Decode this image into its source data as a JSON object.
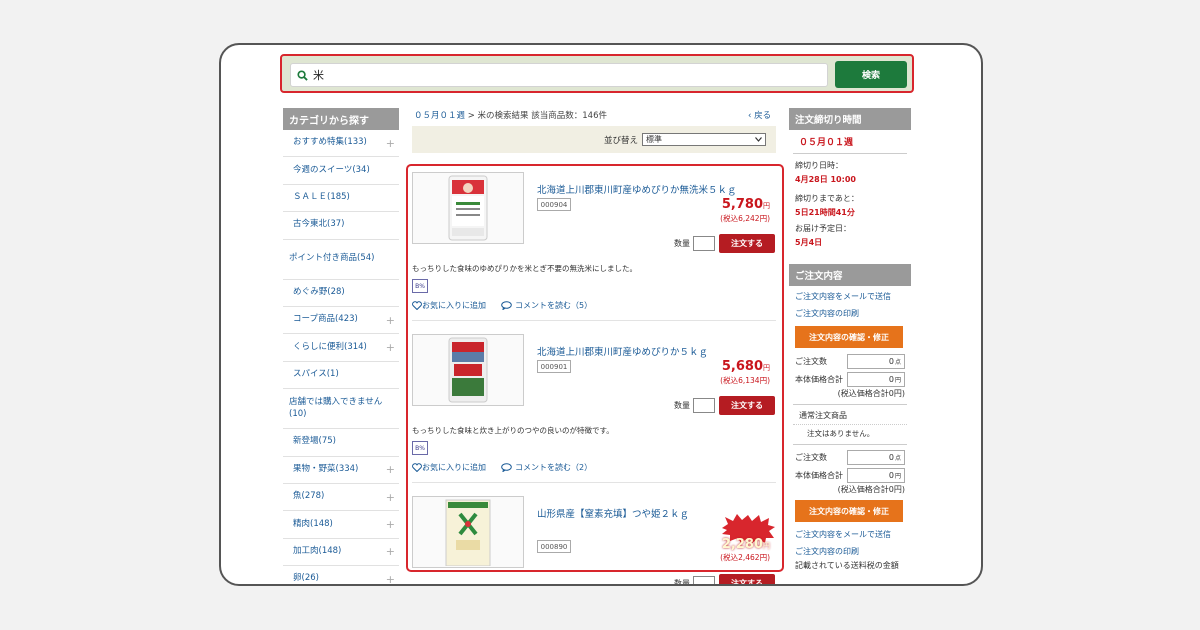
{
  "search": {
    "query": "米",
    "button_label": "検索"
  },
  "categories": {
    "header": "カテゴリから探す",
    "items": [
      {
        "label": "おすすめ特集(133)",
        "plus": true
      },
      {
        "label": "今週のスイーツ(34)",
        "plus": false
      },
      {
        "label": "ＳＡＬＥ(185)",
        "plus": false
      },
      {
        "label": "古今東北(37)",
        "plus": false
      },
      {
        "label": "ポイント付き商品(54)",
        "plus": false
      },
      {
        "label": "めぐみ野(28)",
        "plus": false
      },
      {
        "label": "コープ商品(423)",
        "plus": true
      },
      {
        "label": "くらしに便利(314)",
        "plus": true
      },
      {
        "label": "スパイス(1)",
        "plus": false
      },
      {
        "label": "店舗では購入できません(10)",
        "plus": false
      },
      {
        "label": "新登場(75)",
        "plus": false
      },
      {
        "label": "果物・野菜(334)",
        "plus": true
      },
      {
        "label": "魚(278)",
        "plus": true
      },
      {
        "label": "精肉(148)",
        "plus": true
      },
      {
        "label": "加工肉(148)",
        "plus": true
      },
      {
        "label": "卵(26)",
        "plus": true
      }
    ]
  },
  "breadcrumb": {
    "week_link": "０５月０１週",
    "separator": ">",
    "result_text": "米の検索結果 該当商品数：146件",
    "back_label": "戻る"
  },
  "sort": {
    "label": "並び替え",
    "selected": "標準"
  },
  "products": [
    {
      "name": "北海道上川郡東川町産ゆめぴりか無洗米５ｋｇ",
      "code": "000904",
      "price": "5,780",
      "unit": "円",
      "price_tax": "(税込6,242円)",
      "qty_label": "数量",
      "order_label": "注文する",
      "description": "もっちりした食味のゆめぴりかを米とぎ不要の無洗米にしました。",
      "badge": "B%",
      "fav_label": "お気に入りに追加",
      "comment_label": "コメントを読む（5）"
    },
    {
      "name": "北海道上川郡東川町産ゆめぴりか５ｋｇ",
      "code": "000901",
      "price": "5,680",
      "unit": "円",
      "price_tax": "(税込6,134円)",
      "qty_label": "数量",
      "order_label": "注文する",
      "description": "もっちりした食味と炊き上がりのつやの良いのが特徴です。",
      "badge": "B%",
      "fav_label": "お気に入りに追加",
      "comment_label": "コメントを読む（2）"
    },
    {
      "name": "山形県産【窒素充填】つや姫２ｋｇ",
      "code": "000890",
      "price": "2,280",
      "unit": "円",
      "price_tax": "(税込2,462円)",
      "qty_label": "数量",
      "order_label": "注文する"
    }
  ],
  "deadline": {
    "header": "注文締切り時間",
    "week": "０５月０１週",
    "deadline_label": "締切り日時：",
    "deadline_value": "4月28日 10:00",
    "remaining_label": "締切りまであと：",
    "remaining_value": "5日21時間41分",
    "delivery_label": "お届け予定日：",
    "delivery_value": "5月4日"
  },
  "order": {
    "header": "ご注文内容",
    "email_link": "ご注文内容をメールで送信",
    "print_link": "ご注文内容の印刷",
    "confirm_button": "注文内容の確認・修正",
    "count_label": "ご注文数",
    "count_value": "0",
    "count_unit": "点",
    "subtotal_label": "本体価格合計",
    "subtotal_value": "0",
    "subtotal_unit": "円",
    "tax_total": "(税込価格合計0円)",
    "regular_label": "通常注文商品",
    "empty_text": "注文はありません。",
    "count_value_2": "0",
    "subtotal_value_2": "0",
    "tax_total_2": "(税込価格合計0円)",
    "confirm_button_2": "注文内容の確認・修正",
    "email_link_2": "ご注文内容をメールで送信",
    "print_link_2": "ご注文内容の印刷",
    "footer_text": "記載されている送料税の金額"
  },
  "colors": {
    "accent_red": "#d8262d",
    "search_green": "#1d7a3c",
    "order_orange": "#e6731b"
  }
}
